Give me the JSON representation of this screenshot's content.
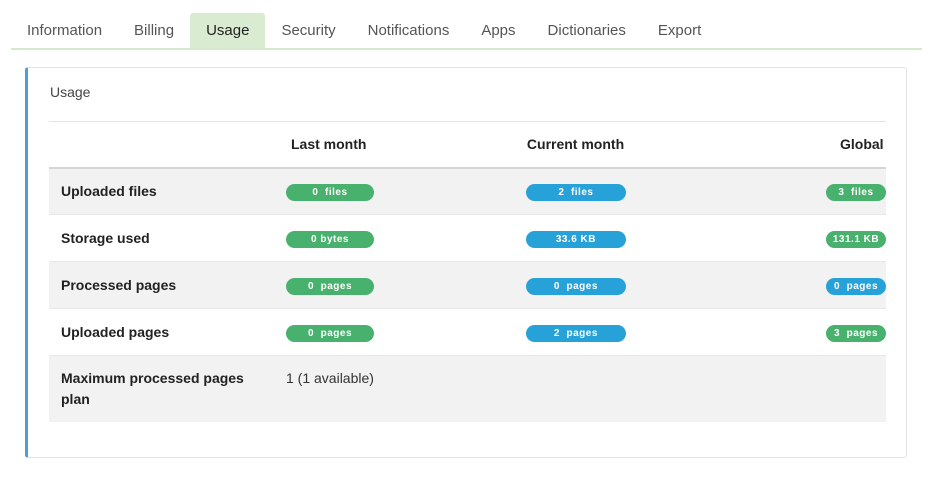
{
  "tabs": [
    {
      "label": "Information",
      "active": false
    },
    {
      "label": "Billing",
      "active": false
    },
    {
      "label": "Usage",
      "active": true
    },
    {
      "label": "Security",
      "active": false
    },
    {
      "label": "Notifications",
      "active": false
    },
    {
      "label": "Apps",
      "active": false
    },
    {
      "label": "Dictionaries",
      "active": false
    },
    {
      "label": "Export",
      "active": false
    }
  ],
  "card": {
    "title": "Usage",
    "columns": [
      "Last month",
      "Current month",
      "Global"
    ],
    "rows": [
      {
        "label": "Uploaded files",
        "last_month": "0  files",
        "current_month": "2  files",
        "global": "3  files"
      },
      {
        "label": "Storage used",
        "last_month": "0 bytes",
        "current_month": "33.6 KB",
        "global": "131.1 KB"
      },
      {
        "label": "Processed pages",
        "last_month": "0  pages",
        "current_month": "0  pages",
        "global": "0  pages"
      },
      {
        "label": "Uploaded pages",
        "last_month": "0  pages",
        "current_month": "2  pages",
        "global": "3  pages"
      }
    ],
    "max_plan": {
      "label": "Maximum processed pages plan",
      "value": "1 (1 available)"
    }
  },
  "colors": {
    "accent_border": "#4b9fd8",
    "tab_active_bg": "#d9ecd2",
    "badge_green": "#48b16d",
    "badge_blue": "#27a2d9"
  }
}
